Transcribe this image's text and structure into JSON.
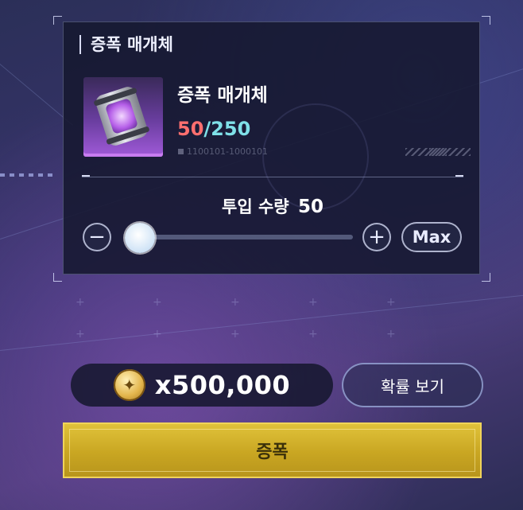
{
  "panel": {
    "title": "증폭 매개체"
  },
  "item": {
    "name": "증폭 매개체",
    "owned": "50",
    "separator": "/",
    "required": "250",
    "code": "1100101-1000101",
    "icon": "purple-canister-icon"
  },
  "input": {
    "label": "투입 수량",
    "value": "50",
    "minus_symbol": "−",
    "plus_symbol": "+",
    "max_label": "Max",
    "slider_level": 0.07
  },
  "cost": {
    "text": "x500,000",
    "coin_symbol": "✦",
    "icon": "gold-coin-icon"
  },
  "buttons": {
    "probability_label": "확률 보기",
    "amplify_label": "증폭"
  },
  "colors": {
    "owned": "#ff6f6f",
    "required": "#7fe0e8",
    "amplify": "#d4b22d"
  }
}
